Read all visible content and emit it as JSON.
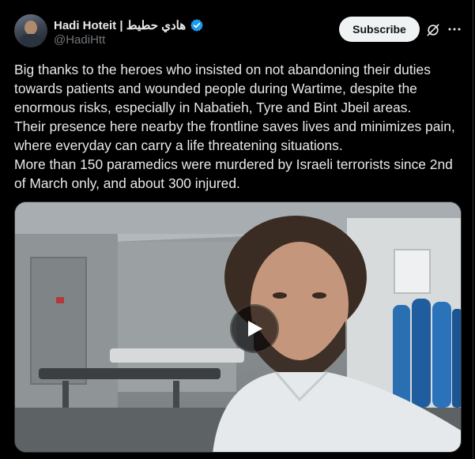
{
  "author": {
    "display_name": "Hadi Hoteit | هادي حطيط",
    "handle": "@HadiHtt",
    "verified_icon": "verified-badge-icon",
    "verified_color": "#1d9bf0"
  },
  "actions": {
    "subscribe_label": "Subscribe",
    "grok_icon": "grok-icon",
    "more_icon": "more-dots-icon"
  },
  "tweet": {
    "paragraphs": [
      "Big thanks to the heroes who insisted on not abandoning their duties towards patients and wounded people during Wartime, despite the enormous risks, especially in Nabatieh, Tyre and Bint Jbeil areas.",
      "Their presence here nearby the frontline saves lives and minimizes pain, where everyday can carry a life threatening situations.",
      "More than 150 paramedics were murdered by Israeli terrorists since 2nd of March only, and about 300 injured."
    ]
  },
  "media": {
    "type": "video",
    "play_icon": "play-icon"
  },
  "colors": {
    "background": "#000000",
    "text": "#e7e9ea",
    "muted": "#71767b",
    "button_bg": "#eff3f4"
  }
}
